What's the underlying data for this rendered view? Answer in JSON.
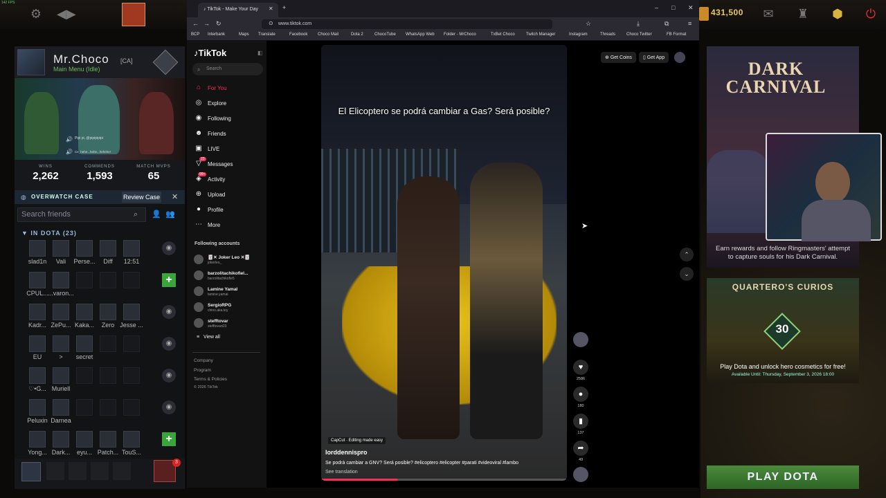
{
  "fps": "142 FPS",
  "dota": {
    "gold": "431,500",
    "profile": {
      "name": "Mr.Choco",
      "tag": "[CA]",
      "status": "Main Menu (Idle)",
      "chat1": "Pipi pi, @pipipipipi",
      "chat2": "Ce_hehe...hehe...hehehe!"
    },
    "stats": [
      {
        "label": "WINS",
        "value": "2,262"
      },
      {
        "label": "COMMENDS",
        "value": "1,593"
      },
      {
        "label": "MATCH MVPS",
        "value": "65"
      }
    ],
    "overwatch": {
      "label": "OVERWATCH CASE",
      "button": "Review Case"
    },
    "friends": {
      "search_placeholder": "Search friends",
      "section": "IN DOTA (23)",
      "rows": [
        [
          "slad1n",
          "Vali",
          "Perse...",
          "Diff",
          "12:51"
        ],
        [
          "CPUL...",
          "...varon...",
          "",
          "",
          ""
        ],
        [
          "Kadr...",
          "ZePu...",
          "Kaka...",
          "Zero",
          "Jesse ..."
        ],
        [
          "EU",
          ">",
          "secret",
          "",
          ""
        ],
        [
          "♡•G...",
          "Muriell",
          "",
          "",
          ""
        ],
        [
          "Peluxin",
          "Darnea",
          "",
          "",
          ""
        ],
        [
          "Yong...",
          "Dark...",
          "eyu...",
          "Patch...",
          "TouS..."
        ]
      ]
    },
    "notif_count": "3"
  },
  "browser": {
    "tab_title": "TikTok - Make Your Day",
    "url": "www.tiktok.com",
    "bookmarks": [
      "BCP",
      "Interbank",
      "Maps",
      "Translate",
      "Facebook",
      "Choco Mail",
      "Dota 2",
      "ChocoTube",
      "WhatsApp Web",
      "Folder - MrChoco",
      "TxBet Choco",
      "Twitch Manager",
      "Instagram",
      "Threads",
      "Choco Twitter",
      "FB Format"
    ]
  },
  "tiktok": {
    "logo": "TikTok",
    "search_placeholder": "Search",
    "menu": [
      {
        "label": "For You",
        "icon": "⌂"
      },
      {
        "label": "Explore",
        "icon": "◎"
      },
      {
        "label": "Following",
        "icon": "◉"
      },
      {
        "label": "Friends",
        "icon": "☻"
      },
      {
        "label": "LIVE",
        "icon": "▣"
      },
      {
        "label": "Messages",
        "icon": "▽"
      },
      {
        "label": "Activity",
        "icon": "◈"
      },
      {
        "label": "Upload",
        "icon": "⊕"
      },
      {
        "label": "Profile",
        "icon": "●"
      },
      {
        "label": "More",
        "icon": "⋯"
      }
    ],
    "messages_badge": "23",
    "activity_badge": "99+",
    "following_header": "Following accounts",
    "accounts": [
      {
        "name": "🃏✕ Joker Leo ✕🃏",
        "handle": "jokerleo_"
      },
      {
        "name": "barzolitachikofiel...",
        "handle": "barzolitachikofie5"
      },
      {
        "name": "Lamine Yamal",
        "handle": "lamine.yamal"
      },
      {
        "name": "SergioRPG",
        "handle": "chino.aka.toy"
      },
      {
        "name": "stefftovar",
        "handle": "stefftovart23"
      }
    ],
    "view_all": "View all",
    "footer": [
      "Company",
      "Program",
      "Terms & Policies",
      "© 2026 TikTok"
    ],
    "get_coins": "Get Coins",
    "get_app": "Get App",
    "video": {
      "caption": "El Elicoptero se podrá cambiar a Gas? Será posible?",
      "capcut": "CapCut · Editing made easy",
      "author": "lorddennispro",
      "description": "Se podrá cambiar a GNV? Será posible? #elicoptero #elicopter #parati #videoviral #lambo",
      "see_translation": "See translation",
      "progress": 0.31
    },
    "actions": {
      "likes": "2586",
      "comments": "180",
      "saves": "137",
      "shares": "49"
    }
  },
  "promo": {
    "carnival_title": "DARK CARNIVAL",
    "carnival_text": "Earn rewards and follow Ringmasters' attempt to capture souls for his Dark Carnival.",
    "curios_title": "QUARTERO'S CURIOS",
    "curios_num": "30",
    "curios_text": "Play Dota and unlock hero cosmetics for free!",
    "curios_date": "Available Until: Thursday, September 3, 2026 18:00",
    "play": "PLAY DOTA"
  }
}
